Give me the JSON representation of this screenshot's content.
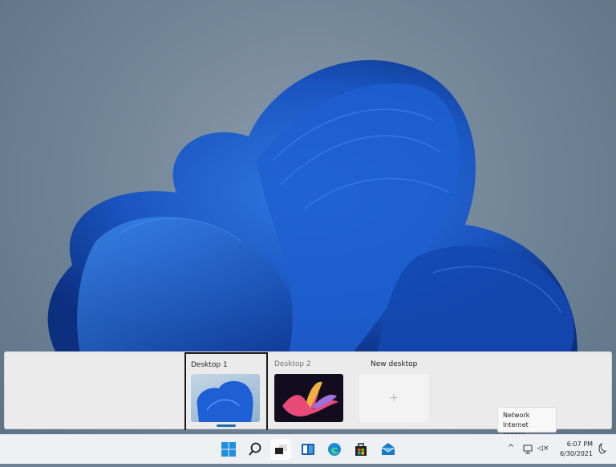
{
  "desktops": [
    {
      "label": "Desktop 1",
      "active": true
    },
    {
      "label": "Desktop 2",
      "active": false
    }
  ],
  "new_desktop": {
    "label": "New desktop",
    "icon": "+"
  },
  "tooltip": {
    "title": "Network",
    "status": "Internet access"
  },
  "taskbar": {
    "apps": [
      "start",
      "search",
      "task-view",
      "widgets",
      "edge",
      "store",
      "mail"
    ]
  },
  "tray": {
    "time": "6:07 PM",
    "date": "6/30/2021",
    "chevron": "^",
    "volume": "◁×"
  },
  "colors": {
    "accent": "#1e6ea8",
    "wallpaper": "#6f8396"
  }
}
